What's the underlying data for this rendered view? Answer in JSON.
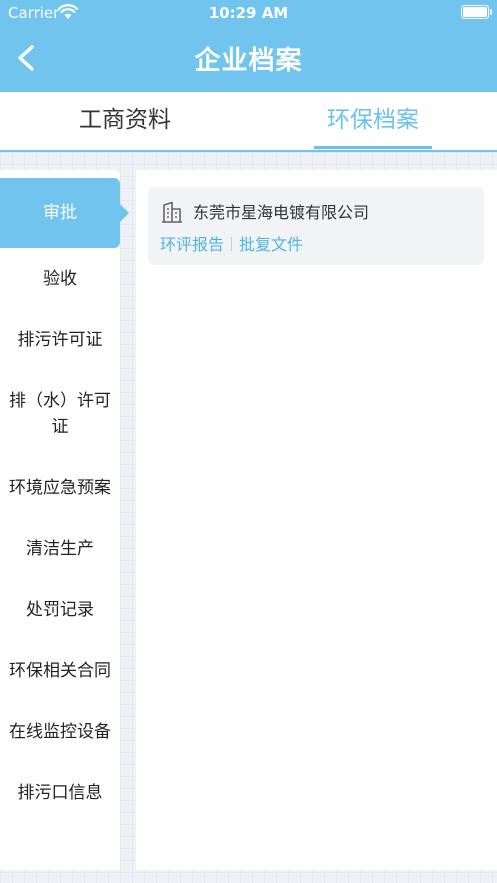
{
  "status_bar": {
    "carrier": "Carrier",
    "time": "10:29 AM"
  },
  "nav": {
    "title": "企业档案"
  },
  "tabs": [
    {
      "label": "工商资料"
    },
    {
      "label": "环保档案"
    }
  ],
  "sidebar": {
    "items": [
      {
        "label": "审批"
      },
      {
        "label": "验收"
      },
      {
        "label": "排污许可证"
      },
      {
        "label": "排（水）许可证"
      },
      {
        "label": "环境应急预案"
      },
      {
        "label": "清洁生产"
      },
      {
        "label": "处罚记录"
      },
      {
        "label": "环保相关合同"
      },
      {
        "label": "在线监控设备"
      },
      {
        "label": "排污口信息"
      }
    ]
  },
  "content": {
    "card": {
      "company": "东莞市星海电镀有限公司",
      "link1": "环评报告",
      "link2": "批复文件"
    }
  },
  "colors": {
    "primary": "#71c4ee",
    "link": "#4db5e6"
  }
}
